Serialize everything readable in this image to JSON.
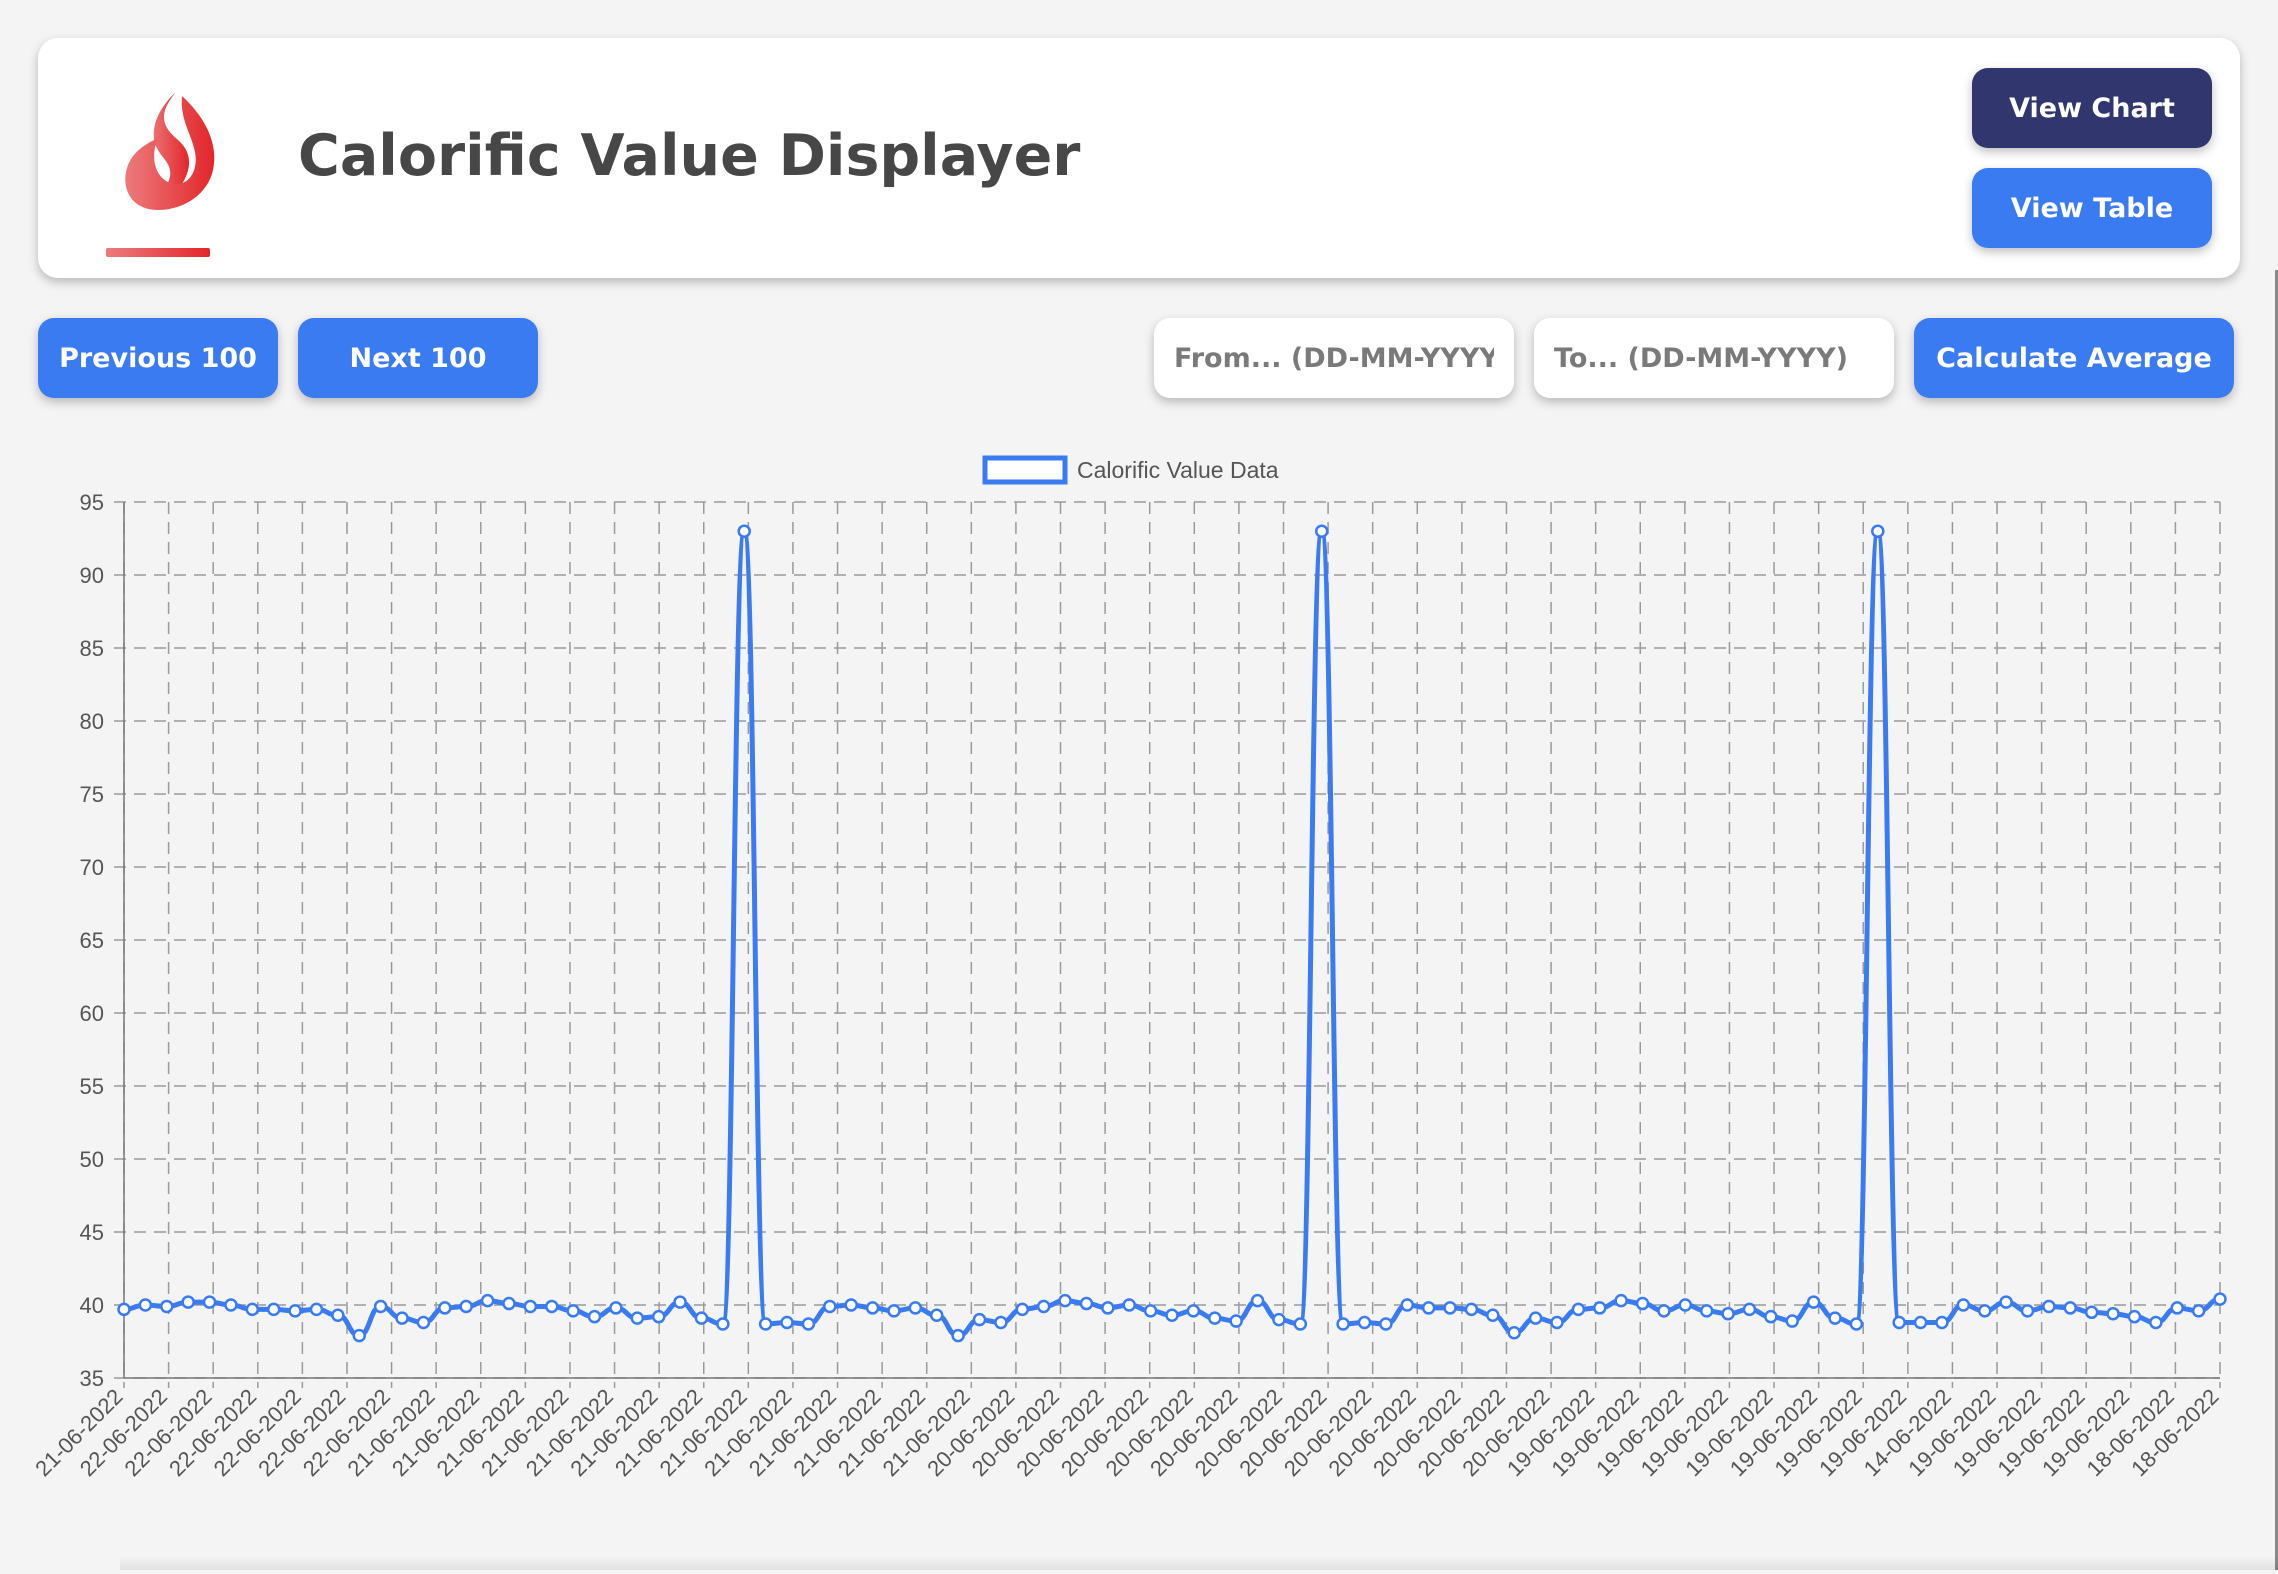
{
  "header": {
    "title": "Calorific Value Displayer",
    "logo_icon": "flame-icon",
    "view_chart_label": "View Chart",
    "view_table_label": "View Table"
  },
  "controls": {
    "previous_label": "Previous 100",
    "next_label": "Next 100",
    "from_placeholder": "From... (DD-MM-YYYY)",
    "to_placeholder": "To... (DD-MM-YYYY)",
    "from_value": "",
    "to_value": "",
    "calculate_label": "Calculate Average"
  },
  "colors": {
    "primary_blue": "#3a7bf2",
    "dark_navy": "#31376e",
    "title_gray": "#474747",
    "flame_red": "#e53935"
  },
  "chart_data": {
    "type": "line",
    "title": "",
    "xlabel": "",
    "ylabel": "",
    "ylim": [
      35,
      95
    ],
    "yticks": [
      95,
      90,
      85,
      80,
      75,
      70,
      65,
      60,
      55,
      50,
      45,
      40,
      35
    ],
    "grid": "dashed",
    "legend_position": "top-center",
    "categories": [
      "21-06-2022",
      "22-06-2022",
      "22-06-2022",
      "22-06-2022",
      "22-06-2022",
      "22-06-2022",
      "22-06-2022",
      "21-06-2022",
      "21-06-2022",
      "21-06-2022",
      "21-06-2022",
      "21-06-2022",
      "21-06-2022",
      "21-06-2022",
      "21-06-2022",
      "21-06-2022",
      "21-06-2022",
      "21-06-2022",
      "21-06-2022",
      "21-06-2022",
      "20-06-2022",
      "20-06-2022",
      "20-06-2022",
      "20-06-2022",
      "20-06-2022",
      "20-06-2022",
      "20-06-2022",
      "20-06-2022",
      "20-06-2022",
      "20-06-2022",
      "20-06-2022",
      "20-06-2022",
      "20-06-2022",
      "19-06-2022",
      "19-06-2022",
      "19-06-2022",
      "19-06-2022",
      "19-06-2022",
      "19-06-2022",
      "19-06-2022",
      "19-06-2022",
      "14-06-2022",
      "19-06-2022",
      "19-06-2022",
      "19-06-2022",
      "19-06-2022",
      "18-06-2022",
      "18-06-2022"
    ],
    "series": [
      {
        "name": "Calorific Value Data",
        "color": "#3a7bf2",
        "values": [
          39.7,
          40.0,
          39.9,
          40.2,
          40.2,
          40.0,
          39.7,
          39.7,
          39.6,
          39.7,
          39.3,
          37.9,
          39.9,
          39.1,
          38.8,
          39.8,
          39.9,
          40.3,
          40.1,
          39.9,
          39.9,
          39.6,
          39.2,
          39.8,
          39.1,
          39.2,
          40.2,
          39.1,
          38.7,
          93.0,
          38.7,
          38.8,
          38.7,
          39.9,
          40.0,
          39.8,
          39.6,
          39.8,
          39.3,
          37.9,
          39.0,
          38.8,
          39.7,
          39.9,
          40.3,
          40.1,
          39.8,
          40.0,
          39.6,
          39.3,
          39.6,
          39.1,
          38.9,
          40.3,
          39.0,
          38.7,
          93.0,
          38.7,
          38.8,
          38.7,
          40.0,
          39.8,
          39.8,
          39.7,
          39.3,
          38.1,
          39.1,
          38.8,
          39.7,
          39.8,
          40.3,
          40.1,
          39.6,
          40.0,
          39.6,
          39.4,
          39.7,
          39.2,
          38.9,
          40.2,
          39.1,
          38.7,
          93.0,
          38.8,
          38.8,
          38.8,
          40.0,
          39.6,
          40.2,
          39.6,
          39.9,
          39.8,
          39.5,
          39.4,
          39.2,
          38.8,
          39.8,
          39.6,
          40.4
        ]
      }
    ]
  }
}
